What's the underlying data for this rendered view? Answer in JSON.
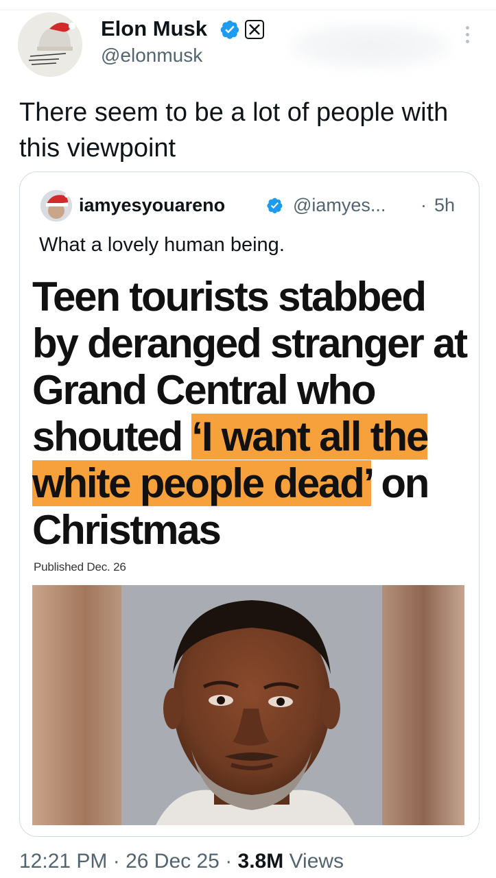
{
  "author": {
    "name": "Elon Musk",
    "handle": "@elonmusk",
    "verified_icon": "verified-badge-icon",
    "x_icon": "x-logo-icon"
  },
  "tweet": {
    "text": "There seem to be a lot of people with this viewpoint"
  },
  "quoted": {
    "name": "iamyesyouareno",
    "handle": "@iamyes...",
    "separator": "·",
    "time": "5h",
    "text": "What a lovely human being.",
    "article": {
      "headline_part1": "Teen tourists stabbed by deranged stranger at Grand Central who shouted ",
      "headline_highlight": "‘I want all the white people dead’",
      "headline_part2": " on Christmas",
      "published": "Published Dec. 26"
    }
  },
  "meta": {
    "time": "12:21 PM",
    "sep1": " · ",
    "date": "26 Dec 25",
    "sep2": " · ",
    "views_count": "3.8M",
    "views_label": " Views"
  },
  "colors": {
    "highlight": "#f6a13c",
    "verified": "#1d9bf0",
    "secondary_text": "#536471"
  }
}
